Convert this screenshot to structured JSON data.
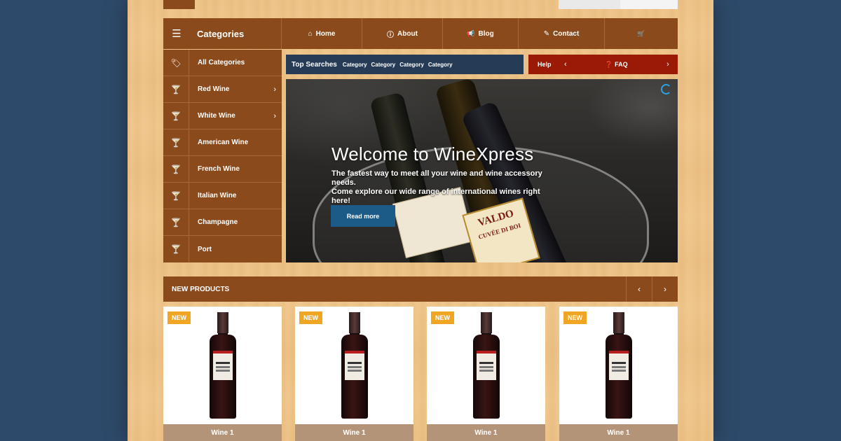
{
  "nav": {
    "categories_label": "Categories",
    "items": [
      {
        "label": "Home",
        "icon": "home-icon",
        "glyph": "⌂"
      },
      {
        "label": "About",
        "icon": "info-icon",
        "glyph": "ⓘ"
      },
      {
        "label": "Blog",
        "icon": "bullhorn-icon",
        "glyph": "📢"
      },
      {
        "label": "Contact",
        "icon": "edit-icon",
        "glyph": "✎"
      },
      {
        "label": "",
        "icon": "cart-icon",
        "glyph": "🛒"
      }
    ]
  },
  "sidebar": {
    "items": [
      {
        "label": "All Categories",
        "icon": "tags-icon",
        "has_arrow": false
      },
      {
        "label": "Red Wine",
        "icon": "glass-icon",
        "has_arrow": true
      },
      {
        "label": "White Wine",
        "icon": "glass-icon",
        "has_arrow": true
      },
      {
        "label": "American Wine",
        "icon": "glass-icon",
        "has_arrow": false
      },
      {
        "label": "French Wine",
        "icon": "glass-icon",
        "has_arrow": false
      },
      {
        "label": "Italian Wine",
        "icon": "glass-icon",
        "has_arrow": false
      },
      {
        "label": "Champagne",
        "icon": "glass-icon",
        "has_arrow": false
      },
      {
        "label": "Port",
        "icon": "glass-icon",
        "has_arrow": false
      }
    ]
  },
  "search": {
    "label": "Top Searches",
    "categories": [
      "Category",
      "Category",
      "Category",
      "Category"
    ]
  },
  "help": {
    "label": "Help",
    "faq_label": "FAQ"
  },
  "hero": {
    "title": "Welcome to WineXpress",
    "subtitle_line1": "The fastest way to meet all your wine and wine accessory needs.",
    "subtitle_line2": "Come explore our wide range of international wines right here!",
    "button_label": "Read more",
    "bottle_label_brand": "VALDO",
    "bottle_label_sub": "CUVÉE DI BOI"
  },
  "new_products": {
    "label": "NEW PRODUCTS",
    "items": [
      {
        "badge": "NEW",
        "name": "Wine 1"
      },
      {
        "badge": "NEW",
        "name": "Wine 1"
      },
      {
        "badge": "NEW",
        "name": "Wine 1"
      },
      {
        "badge": "NEW",
        "name": "Wine 1"
      }
    ]
  },
  "colors": {
    "brand_brown": "#8b4a1c",
    "search_navy": "#253b56",
    "help_red": "#9b1a06",
    "button_blue": "#1c5a87",
    "badge_orange": "#f0a623",
    "background": "#2e4a6a"
  }
}
